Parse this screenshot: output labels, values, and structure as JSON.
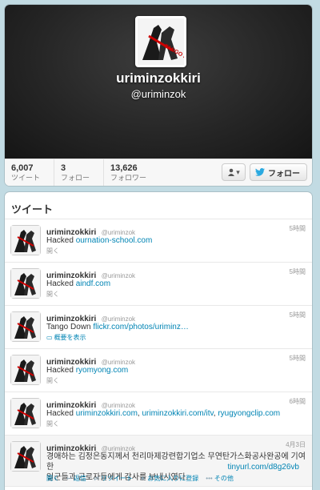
{
  "profile": {
    "name": "uriminzokkiri",
    "handle": "@uriminzok",
    "avatar_text": "TANGO DOWN"
  },
  "stats": [
    {
      "value": "6,007",
      "label": "ツイート"
    },
    {
      "value": "3",
      "label": "フォロー"
    },
    {
      "value": "13,626",
      "label": "フォロワー"
    }
  ],
  "actions": {
    "user_menu_icon": "user-icon",
    "follow_label": "フォロー"
  },
  "tweets_title": "ツイート",
  "tweets": [
    {
      "name": "uriminzokkiri",
      "handle": "@uriminzok",
      "time": "5時間",
      "prefix": "Hacked ",
      "links": [
        "ournation-school.com"
      ],
      "action": "開く"
    },
    {
      "name": "uriminzokkiri",
      "handle": "@uriminzok",
      "time": "5時間",
      "prefix": "Hacked ",
      "links": [
        "aindf.com"
      ],
      "action": "開く"
    },
    {
      "name": "uriminzokkiri",
      "handle": "@uriminzok",
      "time": "5時間",
      "prefix": "Tango Down ",
      "links": [
        "flickr.com/photos/uriminz…"
      ],
      "action": "概要を表示"
    },
    {
      "name": "uriminzokkiri",
      "handle": "@uriminzok",
      "time": "5時間",
      "prefix": "Hacked  ",
      "links": [
        "ryomyong.com"
      ],
      "action": "開く"
    },
    {
      "name": "uriminzokkiri",
      "handle": "@uriminzok",
      "time": "6時間",
      "prefix": "Hacked ",
      "links": [
        "uriminzokkiri.com",
        "uriminzokkiri.com/itv",
        "ryugyongclip.com"
      ],
      "action": "開く"
    },
    {
      "name": "uriminzokkiri",
      "handle": "@uriminzok",
      "time": "4月3日",
      "line1": "경애하는 김정은동지께서 천리마제강련합기업소 무연탄가스화공사완공에 기여한",
      "line2": "일군들과 근로자들에게 감사를 보내시였다.",
      "link": "tinyurl.com/d8g26vb",
      "actions": [
        "開く",
        "返信",
        "リツイート",
        "お気に入りに登録",
        "その他"
      ]
    }
  ]
}
